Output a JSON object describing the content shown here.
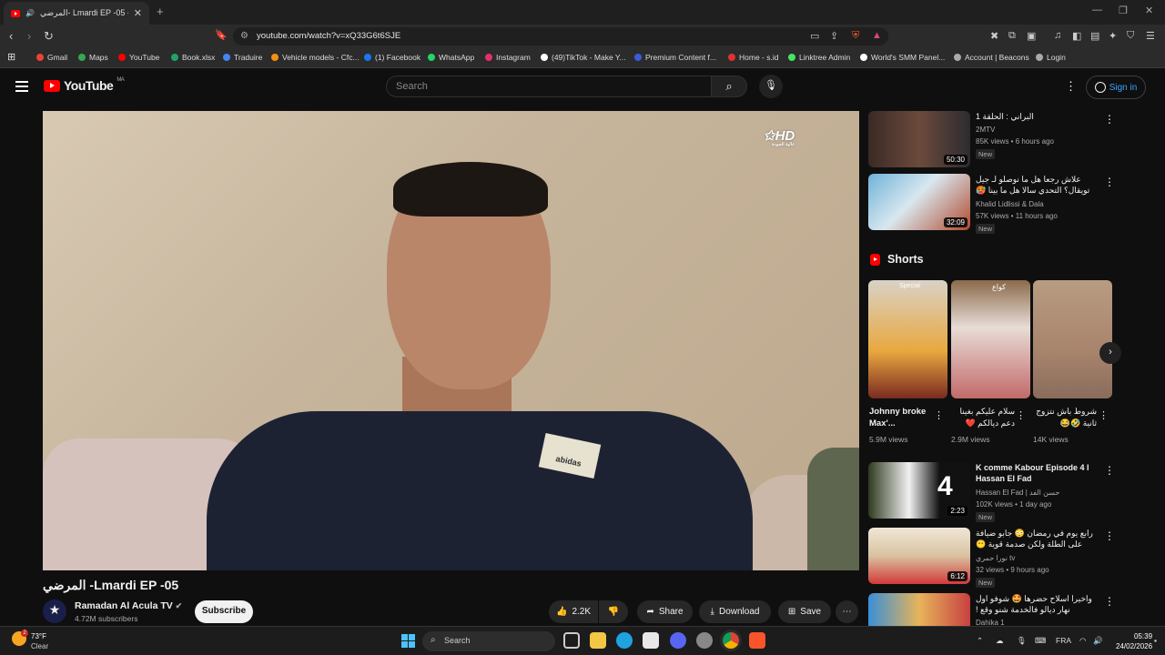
{
  "browser": {
    "tab_title": "المرضي- Lmardi EP -05 - YouTube",
    "url": "youtube.com/watch?v=xQ33G6t6SJE",
    "bookmarks": [
      {
        "label": "Gmail",
        "color": "#ea4335"
      },
      {
        "label": "Maps",
        "color": "#34a853"
      },
      {
        "label": "YouTube",
        "color": "#ff0000"
      },
      {
        "label": "Book.xlsx",
        "color": "#21a366"
      },
      {
        "label": "Traduire",
        "color": "#4285f4"
      },
      {
        "label": "Vehicle models - Cfc...",
        "color": "#f29111"
      },
      {
        "label": "(1) Facebook",
        "color": "#1877f2"
      },
      {
        "label": "WhatsApp",
        "color": "#25d366"
      },
      {
        "label": "Instagram",
        "color": "#e1306c"
      },
      {
        "label": "(49)TikTok - Make Y...",
        "color": "#ffffff"
      },
      {
        "label": "Premium Content f...",
        "color": "#3b5bdb"
      },
      {
        "label": "Home - s.id",
        "color": "#e03131"
      },
      {
        "label": "Linktree Admin",
        "color": "#43e660"
      },
      {
        "label": "World's SMM Panel...",
        "color": "#ffffff"
      },
      {
        "label": "Account | Beacons",
        "color": "#aaaaaa"
      },
      {
        "label": "Login",
        "color": "#aaaaaa"
      }
    ]
  },
  "youtube": {
    "logo_text": "YouTube",
    "region": "MA",
    "search_placeholder": "Search",
    "sign_in": "Sign in"
  },
  "player": {
    "channel_watermark": "HD",
    "watermark_sub": "عالية الجودة",
    "patch_text": "abidas"
  },
  "video": {
    "title": "المرضي -Lmardi EP -05",
    "channel_name": "Ramadan Al Acula TV",
    "subscribers": "4.72M subscribers",
    "subscribe_label": "Subscribe",
    "likes": "2.2K",
    "share_label": "Share",
    "download_label": "Download",
    "save_label": "Save"
  },
  "sidebar": {
    "items": [
      {
        "title": "البراني : الحلقة 1",
        "channel": "2MTV",
        "meta": "85K views • 6 hours ago",
        "badge": "New",
        "duration": "50:30"
      },
      {
        "title": "علاش رجعا هل ما نوصلو لـ جيل تويقال؟ التحدي سالا هل ما بينا 🥵",
        "channel": "Khalid Lidlissi & Dala",
        "meta": "57K views • 11 hours ago",
        "badge": "New",
        "duration": "32:09"
      },
      {
        "title": "K comme Kabour Episode 4 l Hassan El Fad",
        "channel": "Hassan El Fad | حسن الفد",
        "meta": "102K views • 1 day ago",
        "badge": "New",
        "duration": "2:23"
      },
      {
        "title": "رابع يوم في رمضان 😳 جابو ضيافة على الطلة ولكن صدمة قوية 😶",
        "channel": "نورا حمري tv",
        "meta": "32 views • 9 hours ago",
        "badge": "New",
        "duration": "6:12"
      },
      {
        "title": "واخيرا اسلاح حضرها 🤩 شوفو اول نهار ديالو فالخدمة شنو وقع !",
        "channel": "Dahika 1",
        "meta": "",
        "badge": "",
        "duration": ""
      }
    ],
    "shorts_label": "Shorts",
    "shorts": [
      {
        "title": "Johnny broke Max'...",
        "views": "5.9M views",
        "tag": "Special"
      },
      {
        "title": "سلام عليكم بغينا دعم ديالكم ❤️",
        "views": "2.9M views",
        "tag": "كواع"
      },
      {
        "title": "شروط باش نتزوج ثانية 🤣😂",
        "views": "14K views",
        "tag": ""
      }
    ]
  },
  "taskbar": {
    "temperature": "73°F",
    "weather": "Clear",
    "weather_badge": "2",
    "search": "Search",
    "lang": "FRA",
    "time": "05:39",
    "date": "24/02/2026"
  }
}
